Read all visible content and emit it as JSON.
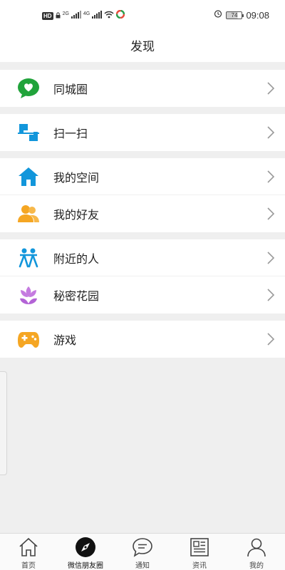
{
  "status_bar": {
    "hd": "HD",
    "net1": "2G",
    "net2": "4G",
    "battery": "74",
    "time": "09:08"
  },
  "header": {
    "title": "发现"
  },
  "groups": [
    {
      "items": [
        {
          "label": "同城圈",
          "icon": "heart-chat-icon",
          "color": "#21a33b"
        }
      ]
    },
    {
      "items": [
        {
          "label": "扫一扫",
          "icon": "scan-icon",
          "color": "#1296db"
        }
      ]
    },
    {
      "items": [
        {
          "label": "我的空间",
          "icon": "home-icon",
          "color": "#1296db"
        },
        {
          "label": "我的好友",
          "icon": "friends-icon",
          "color": "#f5a623"
        }
      ]
    },
    {
      "items": [
        {
          "label": "附近的人",
          "icon": "nearby-people-icon",
          "color": "#1296db"
        },
        {
          "label": "秘密花园",
          "icon": "lotus-icon",
          "color": "#c57be0"
        }
      ]
    },
    {
      "items": [
        {
          "label": "游戏",
          "icon": "gamepad-icon",
          "color": "#f5a623"
        }
      ]
    }
  ],
  "tabbar": {
    "tabs": [
      {
        "label": "首页",
        "icon": "home-outline-icon"
      },
      {
        "label": "微信朋友圈",
        "icon": "compass-icon",
        "active": true
      },
      {
        "label": "通知",
        "icon": "chat-bubble-icon"
      },
      {
        "label": "资讯",
        "icon": "news-icon"
      },
      {
        "label": "我的",
        "icon": "person-icon"
      }
    ]
  }
}
